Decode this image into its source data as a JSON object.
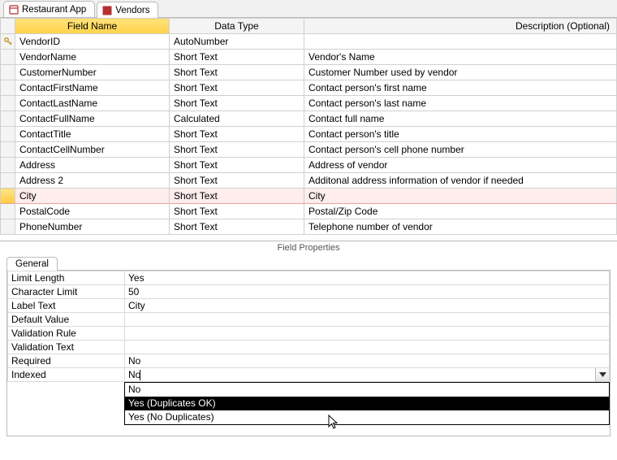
{
  "tabs": [
    {
      "label": "Restaurant App",
      "active": false
    },
    {
      "label": "Vendors",
      "active": true
    }
  ],
  "grid": {
    "headers": {
      "field": "Field Name",
      "type": "Data Type",
      "desc": "Description (Optional)"
    },
    "rows": [
      {
        "pk": true,
        "field": "VendorID",
        "type": "AutoNumber",
        "desc": ""
      },
      {
        "pk": false,
        "field": "VendorName",
        "type": "Short Text",
        "desc": "Vendor's Name"
      },
      {
        "pk": false,
        "field": "CustomerNumber",
        "type": "Short Text",
        "desc": "Customer Number used by vendor"
      },
      {
        "pk": false,
        "field": "ContactFirstName",
        "type": "Short Text",
        "desc": "Contact person's first name"
      },
      {
        "pk": false,
        "field": "ContactLastName",
        "type": "Short Text",
        "desc": "Contact person's last name"
      },
      {
        "pk": false,
        "field": "ContactFullName",
        "type": "Calculated",
        "desc": "Contact full name"
      },
      {
        "pk": false,
        "field": "ContactTitle",
        "type": "Short Text",
        "desc": "Contact person's title"
      },
      {
        "pk": false,
        "field": "ContactCellNumber",
        "type": "Short Text",
        "desc": "Contact person's cell phone number"
      },
      {
        "pk": false,
        "field": "Address",
        "type": "Short Text",
        "desc": "Address of vendor"
      },
      {
        "pk": false,
        "field": "Address 2",
        "type": "Short Text",
        "desc": "Additonal address information of vendor if needed"
      },
      {
        "pk": false,
        "field": "City",
        "type": "Short Text",
        "desc": "City",
        "active": true
      },
      {
        "pk": false,
        "field": "PostalCode",
        "type": "Short Text",
        "desc": "Postal/Zip Code"
      },
      {
        "pk": false,
        "field": "PhoneNumber",
        "type": "Short Text",
        "desc": "Telephone number of vendor"
      }
    ]
  },
  "fieldPropertiesLabel": "Field Properties",
  "propTab": "General",
  "props": [
    {
      "label": "Limit Length",
      "value": "Yes"
    },
    {
      "label": "Character Limit",
      "value": "50"
    },
    {
      "label": "Label Text",
      "value": "City"
    },
    {
      "label": "Default Value",
      "value": ""
    },
    {
      "label": "Validation Rule",
      "value": ""
    },
    {
      "label": "Validation Text",
      "value": ""
    },
    {
      "label": "Required",
      "value": "No"
    },
    {
      "label": "Indexed",
      "value": "No",
      "combo": true
    }
  ],
  "dropdown": {
    "options": [
      "No",
      "Yes (Duplicates OK)",
      "Yes (No Duplicates)"
    ],
    "highlighted": 1
  }
}
